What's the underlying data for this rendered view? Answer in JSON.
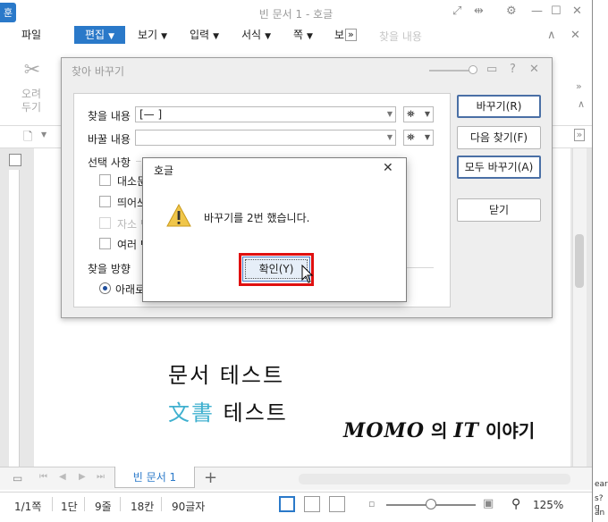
{
  "window": {
    "app_icon_label": "훈",
    "title": "빈 문서 1 - 호글"
  },
  "menu": {
    "items": [
      "파일",
      "편집",
      "보기",
      "입력",
      "서식",
      "쪽",
      "보"
    ],
    "active": "편집",
    "more": "»",
    "search_placeholder": "찾을 내용"
  },
  "toolbar": {
    "cut_label_line1": "오려",
    "cut_label_line2": "두기"
  },
  "find_replace": {
    "title": "찾아 바꾸기",
    "find_label": "찾을 내용",
    "find_value": "[—   ]",
    "replace_label": "바꿀 내용",
    "replace_value": "",
    "options_heading": "선택 사항",
    "options": [
      {
        "label": "대소문",
        "enabled": true
      },
      {
        "label": "띄어쓰",
        "enabled": true
      },
      {
        "label": "자소 단",
        "enabled": false
      },
      {
        "label": "여러 단",
        "enabled": true
      }
    ],
    "direction_heading": "찾을 방향",
    "direction_value": "아래로",
    "buttons": {
      "replace": "바꾸기(R)",
      "find_next": "다음 찾기(F)",
      "replace_all": "모두 바꾸기(A)",
      "close": "닫기"
    }
  },
  "message_box": {
    "title": "호글",
    "message": "바꾸기를 2번 했습니다.",
    "ok_label": "확인(Y)"
  },
  "document": {
    "line1": "문서  테스트",
    "line2_hanja": "文書",
    "line2_rest": "  테스트",
    "watermark_strong": "MOMO",
    "watermark_rest": " 의 ",
    "watermark_it": "IT",
    "watermark_end": " 이야기"
  },
  "tabs": {
    "doc_tab": "빈 문서 1",
    "add": "+"
  },
  "status": {
    "page": "1/1쪽",
    "section": "1단",
    "line": "9줄",
    "column": "18칸",
    "chars": "90글자",
    "zoom": "125%",
    "zoom_level": 0.5
  },
  "edge_text": [
    "ear",
    "s?q",
    "an"
  ]
}
